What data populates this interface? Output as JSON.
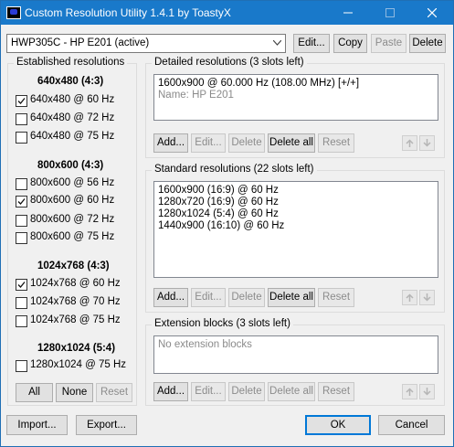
{
  "window": {
    "title": "Custom Resolution Utility 1.4.1 by ToastyX"
  },
  "monitor": {
    "selected": "HWP305C - HP E201 (active)"
  },
  "top_buttons": {
    "edit": "Edit...",
    "copy": "Copy",
    "paste": "Paste",
    "delete": "Delete"
  },
  "established": {
    "group_label": "Established resolutions",
    "sections": [
      {
        "title": "640x480 (4:3)",
        "items": [
          {
            "label": "640x480 @ 60 Hz",
            "checked": true
          },
          {
            "label": "640x480 @ 72 Hz",
            "checked": false
          },
          {
            "label": "640x480 @ 75 Hz",
            "checked": false
          }
        ]
      },
      {
        "title": "800x600 (4:3)",
        "items": [
          {
            "label": "800x600 @ 56 Hz",
            "checked": false
          },
          {
            "label": "800x600 @ 60 Hz",
            "checked": true
          },
          {
            "label": "800x600 @ 72 Hz",
            "checked": false
          },
          {
            "label": "800x600 @ 75 Hz",
            "checked": false
          }
        ]
      },
      {
        "title": "1024x768 (4:3)",
        "items": [
          {
            "label": "1024x768 @ 60 Hz",
            "checked": true
          },
          {
            "label": "1024x768 @ 70 Hz",
            "checked": false
          },
          {
            "label": "1024x768 @ 75 Hz",
            "checked": false
          }
        ]
      },
      {
        "title": "1280x1024 (5:4)",
        "items": [
          {
            "label": "1280x1024 @ 75 Hz",
            "checked": false
          }
        ]
      }
    ],
    "buttons": {
      "all": "All",
      "none": "None",
      "reset": "Reset"
    }
  },
  "detailed": {
    "group_label": "Detailed resolutions (3 slots left)",
    "lines": [
      "1600x900 @ 60.000 Hz (108.00 MHz) [+/+]"
    ],
    "name_line": "Name: HP E201",
    "buttons": {
      "add": "Add...",
      "edit": "Edit...",
      "delete": "Delete",
      "delete_all": "Delete all",
      "reset": "Reset"
    }
  },
  "standard": {
    "group_label": "Standard resolutions (22 slots left)",
    "lines": [
      "1600x900 (16:9) @ 60 Hz",
      "1280x720 (16:9) @ 60 Hz",
      "1280x1024 (5:4) @ 60 Hz",
      "1440x900 (16:10) @ 60 Hz"
    ],
    "buttons": {
      "add": "Add...",
      "edit": "Edit...",
      "delete": "Delete",
      "delete_all": "Delete all",
      "reset": "Reset"
    }
  },
  "extension": {
    "group_label": "Extension blocks (3 slots left)",
    "empty_text": "No extension blocks",
    "buttons": {
      "add": "Add...",
      "edit": "Edit...",
      "delete": "Delete",
      "delete_all": "Delete all",
      "reset": "Reset"
    }
  },
  "footer": {
    "import": "Import...",
    "export": "Export...",
    "ok": "OK",
    "cancel": "Cancel"
  },
  "colors": {
    "titlebar": "#1979ca",
    "accent": "#0078d7",
    "window_bg": "#f0f0f0"
  }
}
